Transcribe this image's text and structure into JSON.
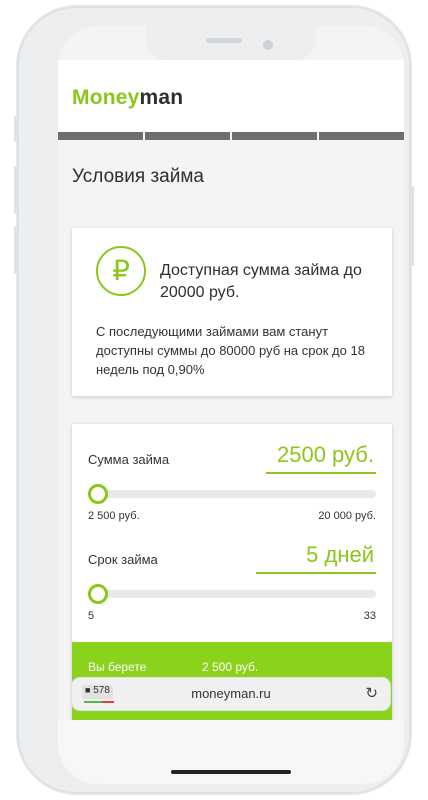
{
  "brand": {
    "part1": "Money",
    "part2": "man",
    "accent": "#8bc71b"
  },
  "progress_segments": 4,
  "page_title": "Условия займа",
  "availability": {
    "icon": "ruble-icon",
    "icon_glyph": "₽",
    "title": "Доступная сумма займа до 20000 руб.",
    "description": "С последующими займами вам станут доступны суммы до 80000 руб на срок до 18 недель под 0,90%"
  },
  "loan_amount": {
    "label": "Сумма займа",
    "value": "2500 руб.",
    "min_label": "2 500  руб.",
    "max_label": "20 000 руб.",
    "level": 0
  },
  "loan_term": {
    "label": "Срок займа",
    "value": "5 дней",
    "min_label": "5",
    "max_label": "33",
    "level": 0
  },
  "summary": {
    "label": "Вы берете",
    "value": "2 500 руб."
  },
  "browser": {
    "tabs_count": "578",
    "url": "moneyman.ru",
    "reload_glyph": "↻"
  }
}
